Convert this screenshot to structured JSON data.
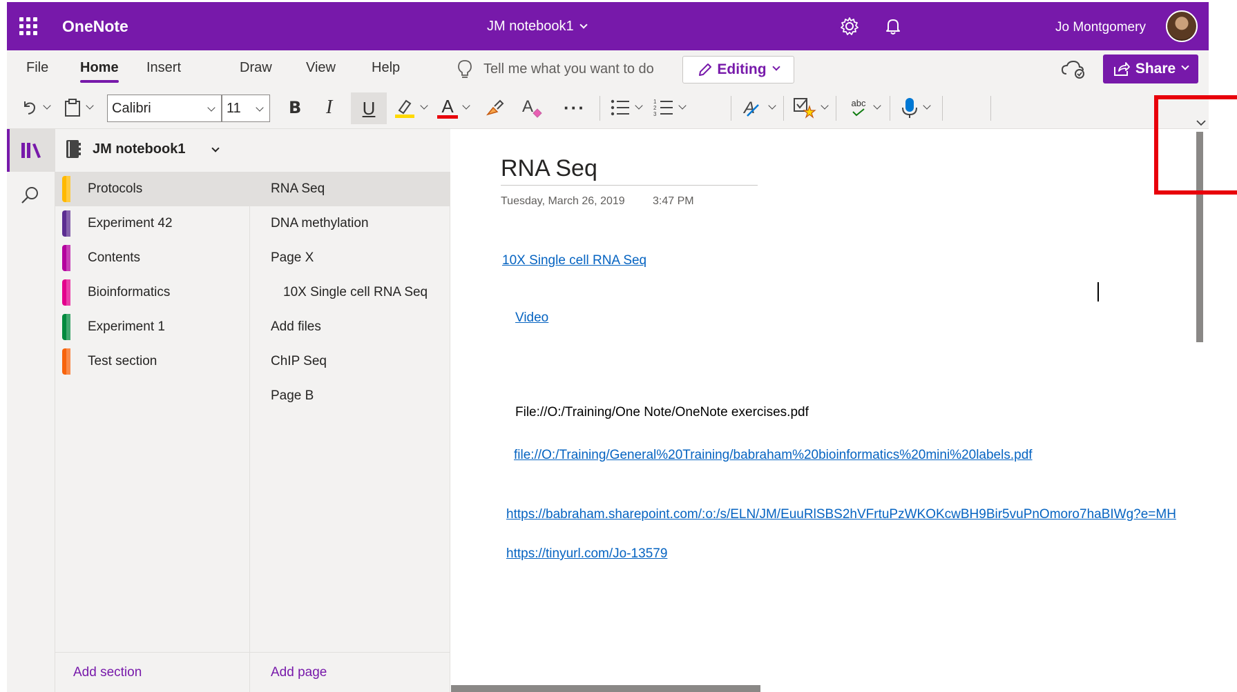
{
  "titlebar": {
    "app_name": "OneNote",
    "notebook_title": "JM notebook1",
    "user_name": "Jo Montgomery",
    "color": "#7719aa"
  },
  "ribbon": {
    "tabs": [
      "File",
      "Home",
      "Insert",
      "Draw",
      "View",
      "Help"
    ],
    "active_tab": "Home",
    "tell_me_placeholder": "Tell me what you want to do",
    "editing_label": "Editing",
    "share_label": "Share"
  },
  "toolbar": {
    "font_name": "Calibri",
    "font_size": "11",
    "bold": "B",
    "italic": "I",
    "underline": "U",
    "font_color": "A",
    "more": "···",
    "spell_abc": "abc"
  },
  "notebook": {
    "name": "JM notebook1",
    "sections": [
      {
        "label": "Protocols",
        "color": "#ffb900"
      },
      {
        "label": "Experiment 42",
        "color": "#5c2d91"
      },
      {
        "label": "Contents",
        "color": "#b4009e"
      },
      {
        "label": "Bioinformatics",
        "color": "#e3008c"
      },
      {
        "label": "Experiment 1",
        "color": "#008a3e"
      },
      {
        "label": "Test section",
        "color": "#f7630c"
      }
    ],
    "pages": [
      {
        "label": "RNA Seq"
      },
      {
        "label": "DNA methylation"
      },
      {
        "label": "Page X"
      },
      {
        "label": "10X Single cell RNA Seq"
      },
      {
        "label": "Add files"
      },
      {
        "label": "ChIP Seq"
      },
      {
        "label": "Page B"
      }
    ],
    "add_section": "Add section",
    "add_page": "Add page"
  },
  "page": {
    "title": "RNA Seq",
    "date": "Tuesday, March 26, 2019",
    "time": "3:47 PM",
    "link_10x": "10X Single cell RNA Seq",
    "link_video": "Video",
    "file_text": "File://O:/Training/One Note/OneNote exercises.pdf",
    "file_link": "file://O:/Training/General%20Training/babraham%20bioinformatics%20mini%20labels.pdf",
    "sharepoint_link": "https://babraham.sharepoint.com/:o:/s/ELN/JM/EuuRlSBS2hVFrtuPzWKOKcwBH9Bir5vuPnOmoro7haBIWg?e=MH",
    "tinyurl_link": "https://tinyurl.com/Jo-13579",
    "link_color": "#0563c1"
  }
}
